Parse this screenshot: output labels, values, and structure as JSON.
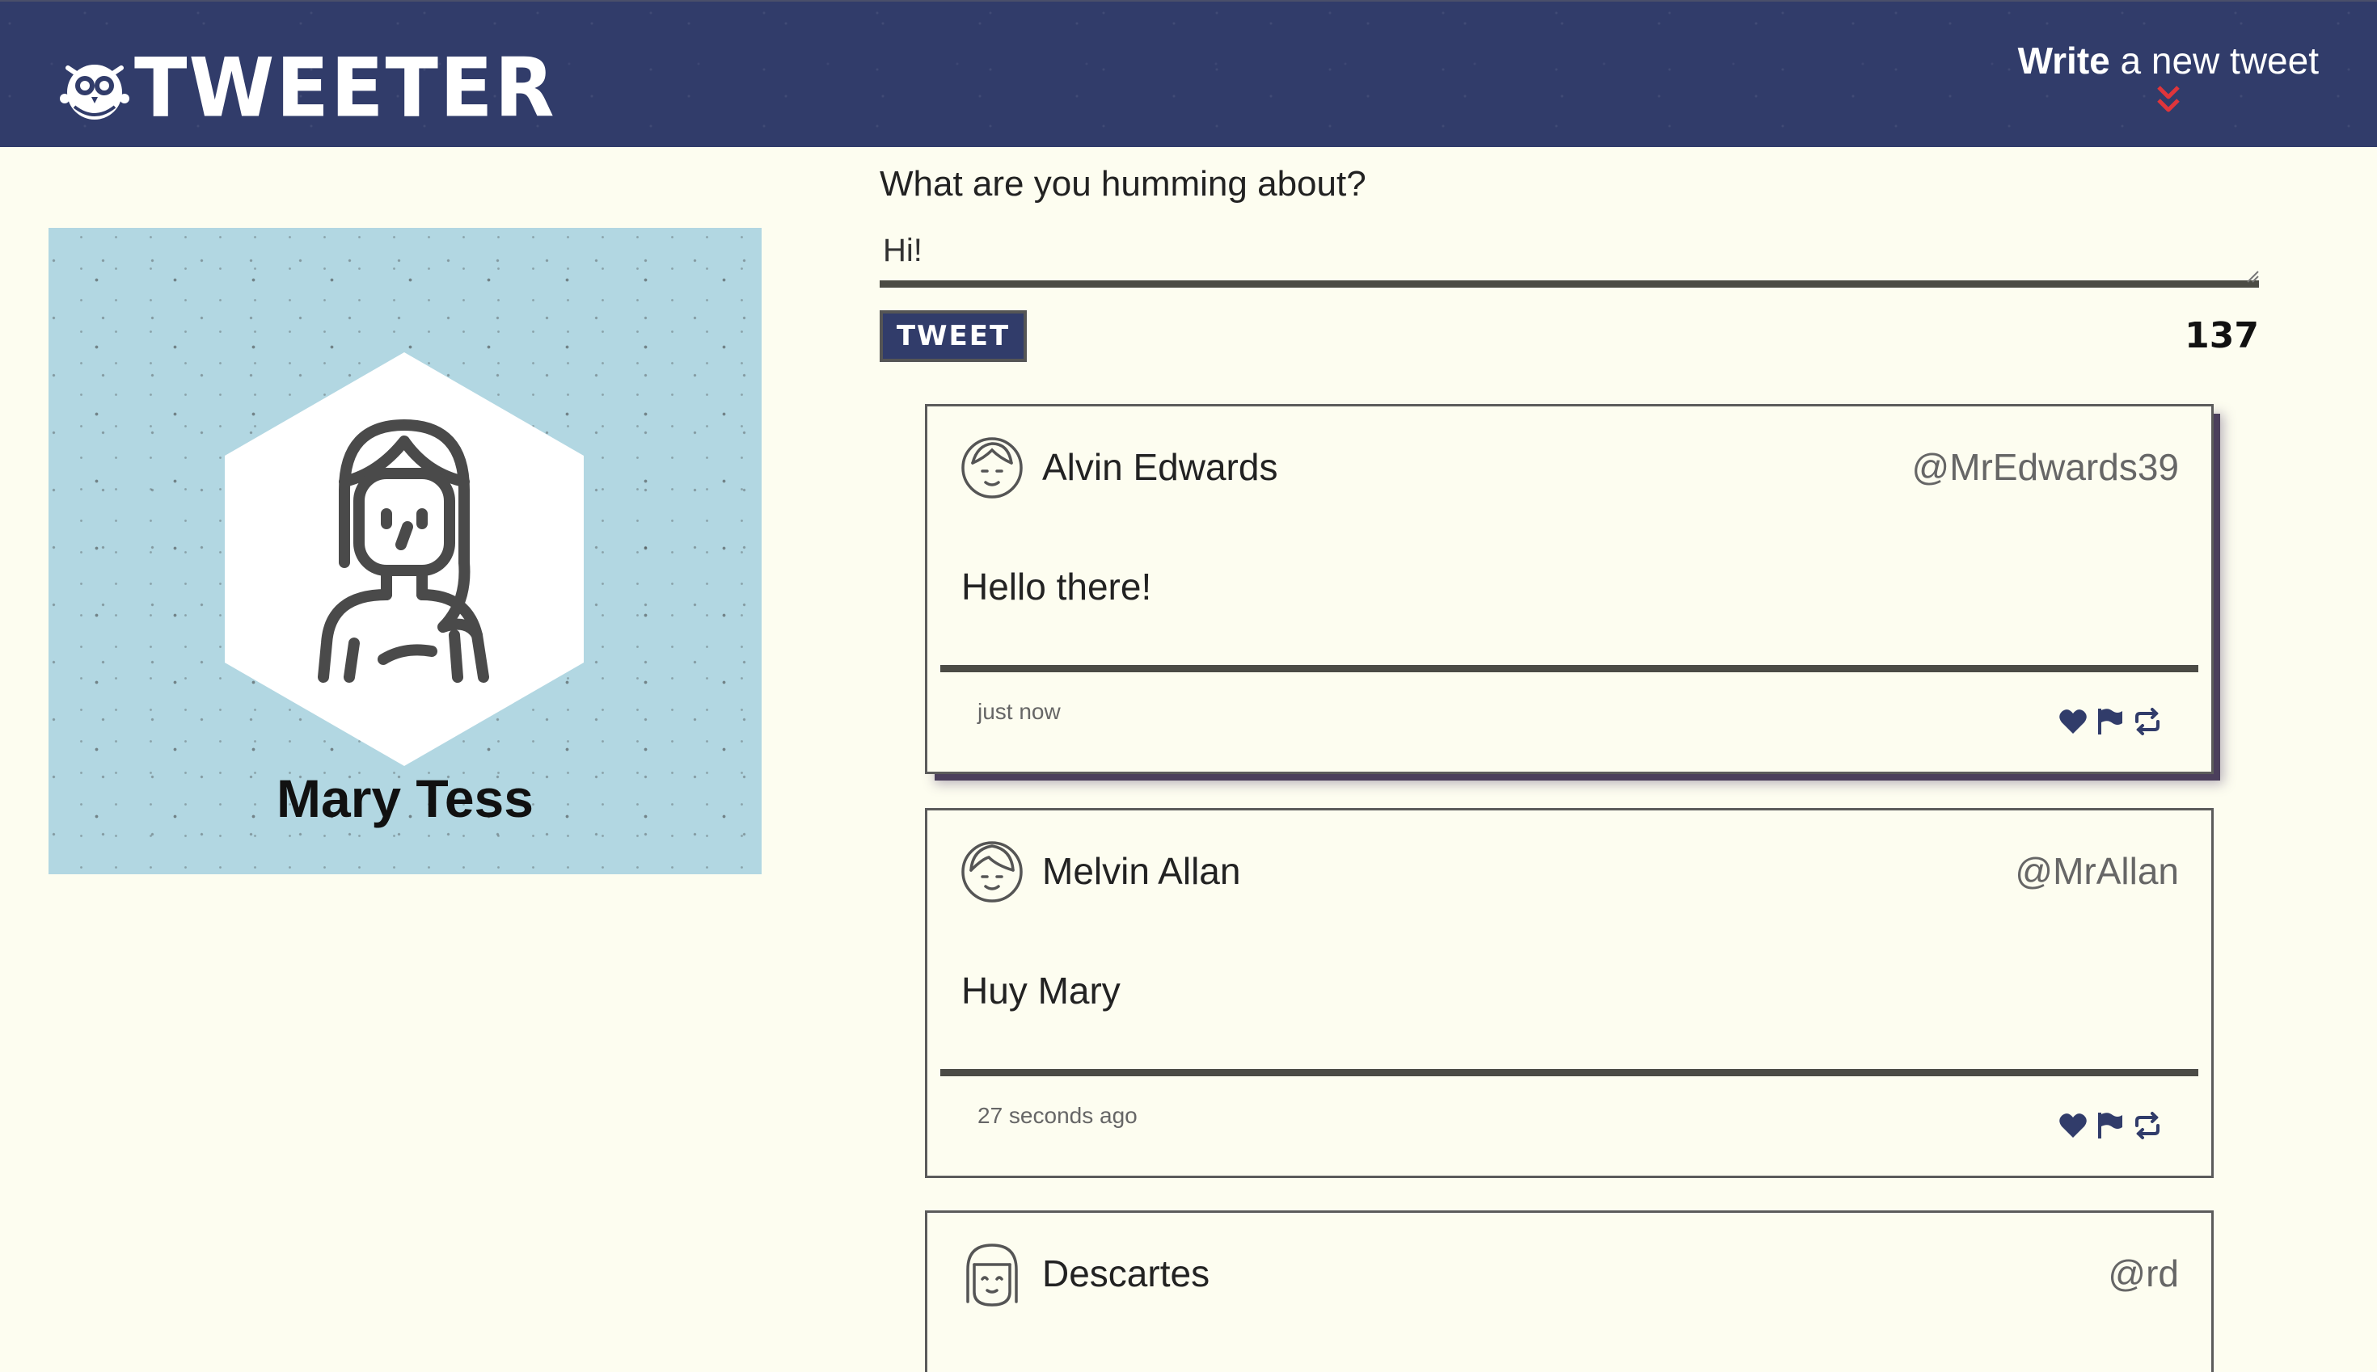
{
  "nav": {
    "logo_text": "TWEETER",
    "compose_toggle_bold": "Write",
    "compose_toggle_rest": " a new tweet",
    "icons": [
      "owl-logo-icon",
      "double-chevron-down-icon"
    ],
    "colors": {
      "nav_bg": "#313c6a",
      "accent": "#e0353b"
    }
  },
  "profile": {
    "name": "Mary Tess",
    "avatar_icon": "woman-avatar-icon",
    "colors": {
      "card_bg": "#b2d7e2"
    }
  },
  "compose": {
    "prompt": "What are you humming about?",
    "input_value": "Hi!",
    "button_label": "TWEET",
    "counter": "137"
  },
  "tweets": [
    {
      "author": "Alvin Edwards",
      "handle": "@MrEdwards39",
      "text": "Hello there!",
      "time": "just now",
      "avatar_icon": "man-avatar-icon"
    },
    {
      "author": "Melvin Allan",
      "handle": "@MrAllan",
      "text": "Huy Mary",
      "time": "27 seconds ago",
      "avatar_icon": "man-avatar-icon"
    },
    {
      "author": "Descartes",
      "handle": "@rd",
      "avatar_icon": "bob-hair-avatar-icon"
    }
  ],
  "action_icons": [
    "heart-icon",
    "flag-icon",
    "retweet-icon"
  ],
  "colors": {
    "page_bg": "#fdfdf0",
    "icon_color": "#313c6a"
  }
}
